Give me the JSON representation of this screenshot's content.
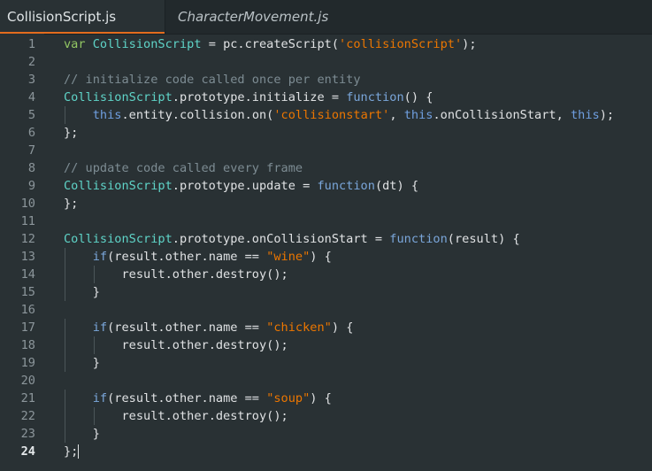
{
  "tabs": [
    {
      "label": "CollisionScript.js",
      "active": true
    },
    {
      "label": "CharacterMovement.js",
      "active": false
    }
  ],
  "colors": {
    "active_tab_underline": "#e36c1e",
    "background": "#293134"
  },
  "current_line": 24,
  "lines": [
    {
      "n": "1",
      "tokens": [
        [
          "kw",
          "var"
        ],
        [
          "plain",
          " "
        ],
        [
          "cls",
          "CollisionScript"
        ],
        [
          "plain",
          " = pc.createScript("
        ],
        [
          "str",
          "'collisionScript'"
        ],
        [
          "plain",
          ");"
        ]
      ]
    },
    {
      "n": "2",
      "tokens": []
    },
    {
      "n": "3",
      "tokens": [
        [
          "cm",
          "// initialize code called once per entity"
        ]
      ]
    },
    {
      "n": "4",
      "tokens": [
        [
          "cls",
          "CollisionScript"
        ],
        [
          "plain",
          ".prototype.initialize = "
        ],
        [
          "fn",
          "function"
        ],
        [
          "plain",
          "() {"
        ]
      ]
    },
    {
      "n": "5",
      "indent": 1,
      "tokens": [
        [
          "this",
          "this"
        ],
        [
          "plain",
          ".entity.collision.on("
        ],
        [
          "str",
          "'collisionstart'"
        ],
        [
          "plain",
          ", "
        ],
        [
          "this",
          "this"
        ],
        [
          "plain",
          ".onCollisionStart, "
        ],
        [
          "this",
          "this"
        ],
        [
          "plain",
          ");"
        ]
      ]
    },
    {
      "n": "6",
      "tokens": [
        [
          "plain",
          "};"
        ]
      ]
    },
    {
      "n": "7",
      "tokens": []
    },
    {
      "n": "8",
      "tokens": [
        [
          "cm",
          "// update code called every frame"
        ]
      ]
    },
    {
      "n": "9",
      "tokens": [
        [
          "cls",
          "CollisionScript"
        ],
        [
          "plain",
          ".prototype.update = "
        ],
        [
          "fn",
          "function"
        ],
        [
          "plain",
          "(dt) {"
        ]
      ]
    },
    {
      "n": "10",
      "tokens": [
        [
          "plain",
          "};"
        ]
      ]
    },
    {
      "n": "11",
      "tokens": []
    },
    {
      "n": "12",
      "tokens": [
        [
          "cls",
          "CollisionScript"
        ],
        [
          "plain",
          ".prototype.onCollisionStart = "
        ],
        [
          "fn",
          "function"
        ],
        [
          "plain",
          "(result) {"
        ]
      ]
    },
    {
      "n": "13",
      "indent": 1,
      "tokens": [
        [
          "fn",
          "if"
        ],
        [
          "plain",
          "(result.other.name == "
        ],
        [
          "str",
          "\"wine\""
        ],
        [
          "plain",
          ") {"
        ]
      ]
    },
    {
      "n": "14",
      "indent": 2,
      "tokens": [
        [
          "plain",
          "result.other.destroy();"
        ]
      ]
    },
    {
      "n": "15",
      "indent": 1,
      "tokens": [
        [
          "plain",
          "}"
        ]
      ]
    },
    {
      "n": "16",
      "tokens": []
    },
    {
      "n": "17",
      "indent": 1,
      "tokens": [
        [
          "fn",
          "if"
        ],
        [
          "plain",
          "(result.other.name == "
        ],
        [
          "str",
          "\"chicken\""
        ],
        [
          "plain",
          ") {"
        ]
      ]
    },
    {
      "n": "18",
      "indent": 2,
      "tokens": [
        [
          "plain",
          "result.other.destroy();"
        ]
      ]
    },
    {
      "n": "19",
      "indent": 1,
      "tokens": [
        [
          "plain",
          "}"
        ]
      ]
    },
    {
      "n": "20",
      "tokens": []
    },
    {
      "n": "21",
      "indent": 1,
      "tokens": [
        [
          "fn",
          "if"
        ],
        [
          "plain",
          "(result.other.name == "
        ],
        [
          "str",
          "\"soup\""
        ],
        [
          "plain",
          ") {"
        ]
      ]
    },
    {
      "n": "22",
      "indent": 2,
      "tokens": [
        [
          "plain",
          "result.other.destroy();"
        ]
      ]
    },
    {
      "n": "23",
      "indent": 1,
      "tokens": [
        [
          "plain",
          "}"
        ]
      ]
    },
    {
      "n": "24",
      "tokens": [
        [
          "plain",
          "};"
        ]
      ]
    }
  ]
}
